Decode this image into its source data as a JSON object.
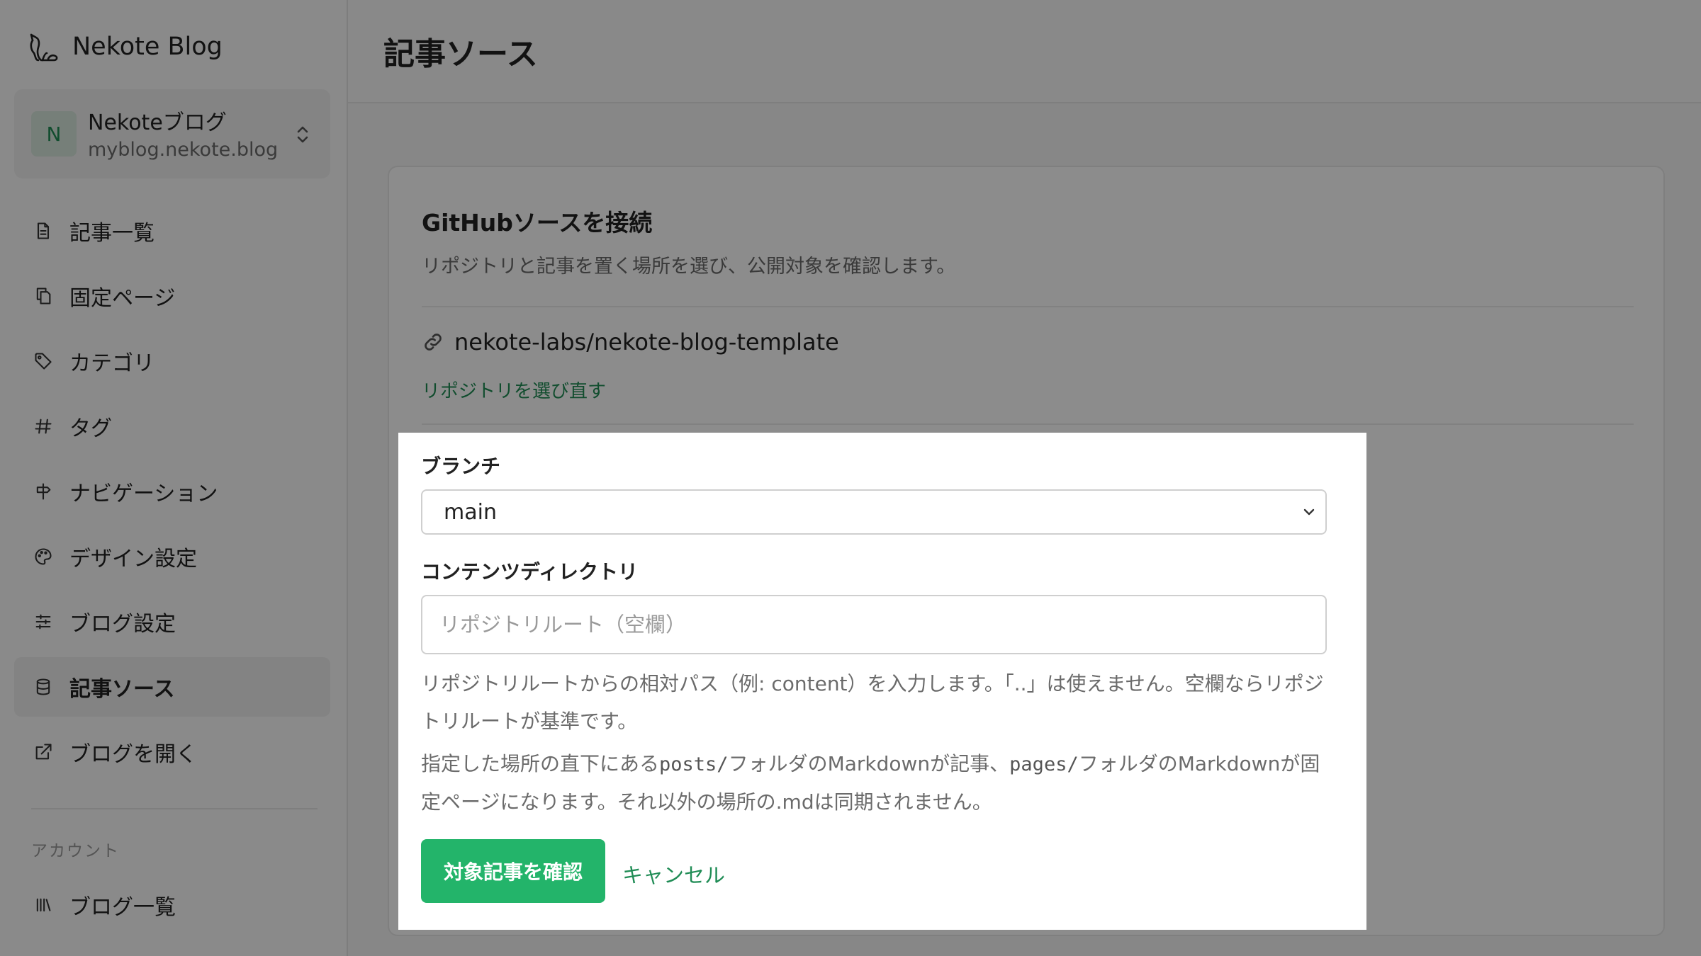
{
  "brand": {
    "name": "Nekote Blog",
    "icon": "cat-icon"
  },
  "blog_switcher": {
    "initial": "N",
    "name": "Nekoteブログ",
    "domain": "myblog.nekote.blog"
  },
  "sidebar": {
    "items": [
      {
        "label": "記事一覧",
        "icon": "document-icon",
        "active": false
      },
      {
        "label": "固定ページ",
        "icon": "copy-icon",
        "active": false
      },
      {
        "label": "カテゴリ",
        "icon": "tag-icon",
        "active": false
      },
      {
        "label": "タグ",
        "icon": "hash-icon",
        "active": false
      },
      {
        "label": "ナビゲーション",
        "icon": "signpost-icon",
        "active": false
      },
      {
        "label": "デザイン設定",
        "icon": "palette-icon",
        "active": false
      },
      {
        "label": "ブログ設定",
        "icon": "sliders-icon",
        "active": false
      },
      {
        "label": "記事ソース",
        "icon": "database-icon",
        "active": true
      },
      {
        "label": "ブログを開く",
        "icon": "external-link-icon",
        "active": false
      }
    ],
    "account_section_label": "アカウント",
    "account_items": [
      {
        "label": "ブログ一覧",
        "icon": "library-icon"
      }
    ]
  },
  "header": {
    "title": "記事ソース"
  },
  "card": {
    "title": "GitHubソースを接続",
    "description": "リポジトリと記事を置く場所を選び、公開対象を確認します。",
    "repo_name": "nekote-labs/nekote-blog-template",
    "rechoose_link": "リポジトリを選び直す"
  },
  "form": {
    "branch_label": "ブランチ",
    "branch_value": "main",
    "directory_label": "コンテンツディレクトリ",
    "directory_value": "",
    "directory_placeholder": "リポジトリルート（空欄）",
    "help_1": "リポジトリルートからの相対パス（例: content）を入力します。「..」は使えません。空欄ならリポジトリルートが基準です。",
    "help_2": {
      "part_1": "指定した場所の直下にある",
      "code_1": "posts/",
      "part_2": "フォルダのMarkdownが記事、",
      "code_2": "pages/",
      "part_3": "フォルダのMarkdownが固定ページになります。それ以外の場所の.mdは同期されません。"
    },
    "confirm_button": "対象記事を確認",
    "cancel_link": "キャンセル"
  },
  "colors": {
    "accent": "#23b46a",
    "link": "#1f8c55",
    "overlay": "rgba(0,0,0,0.45)"
  }
}
